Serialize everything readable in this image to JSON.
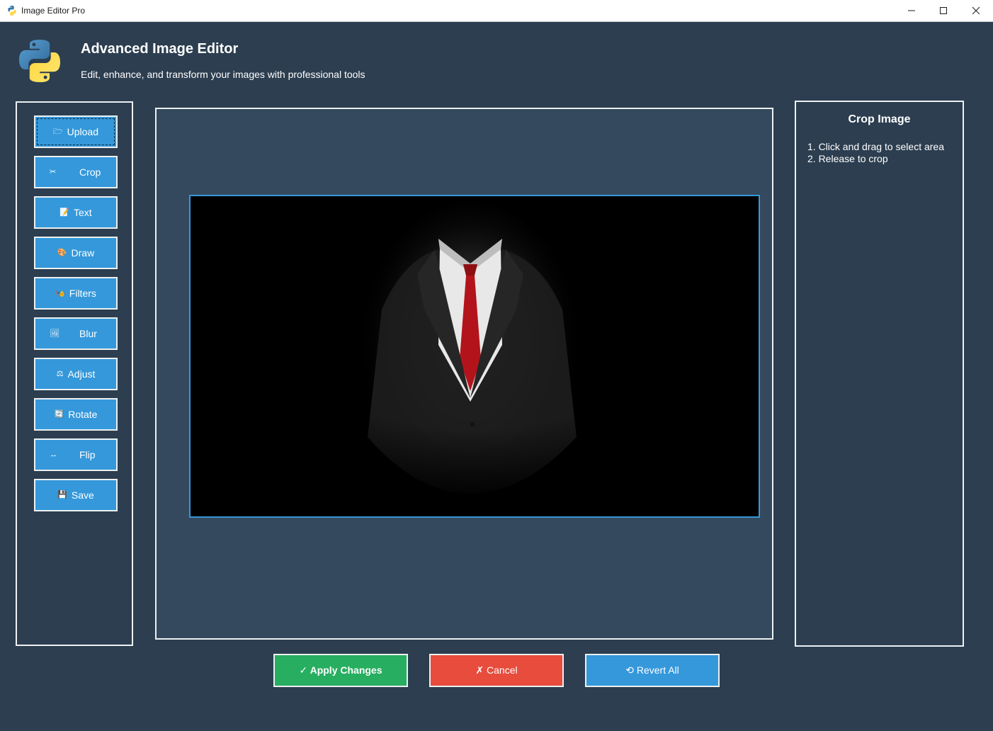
{
  "window": {
    "title": "Image Editor Pro",
    "controls": {
      "minimize": "─",
      "maximize": "☐",
      "close": "✕"
    }
  },
  "header": {
    "title": "Advanced Image Editor",
    "subtitle": "Edit, enhance, and transform your images with professional tools",
    "logo_icon": "python-logo-icon"
  },
  "tools": [
    {
      "icon": "🗁",
      "icon_name": "folder-icon",
      "label": "Upload"
    },
    {
      "icon": "✂",
      "icon_name": "scissors-icon",
      "label": "Crop"
    },
    {
      "icon": "📝",
      "icon_name": "memo-icon",
      "label": "Text"
    },
    {
      "icon": "🎨",
      "icon_name": "palette-icon",
      "label": "Draw"
    },
    {
      "icon": "🎭",
      "icon_name": "masks-icon",
      "label": "Filters"
    },
    {
      "icon": "🖼",
      "icon_name": "picture-icon",
      "label": "Blur"
    },
    {
      "icon": "⚖",
      "icon_name": "scale-icon",
      "label": "Adjust"
    },
    {
      "icon": "🔄",
      "icon_name": "rotate-icon",
      "label": "Rotate"
    },
    {
      "icon": "↔",
      "icon_name": "left-right-arrow-icon",
      "label": "Flip"
    },
    {
      "icon": "💾",
      "icon_name": "floppy-disk-icon",
      "label": "Save"
    }
  ],
  "info_panel": {
    "title": "Crop Image",
    "steps": [
      "1. Click and drag to select area",
      "2. Release to crop"
    ]
  },
  "actions": {
    "apply": "✓ Apply Changes",
    "cancel": "✗ Cancel",
    "revert": "⟲ Revert All"
  },
  "colors": {
    "background": "#2c3e50",
    "canvas": "#34495e",
    "primary": "#3498db",
    "success": "#27ae60",
    "danger": "#e74c3c",
    "border": "#ecf0f1"
  }
}
